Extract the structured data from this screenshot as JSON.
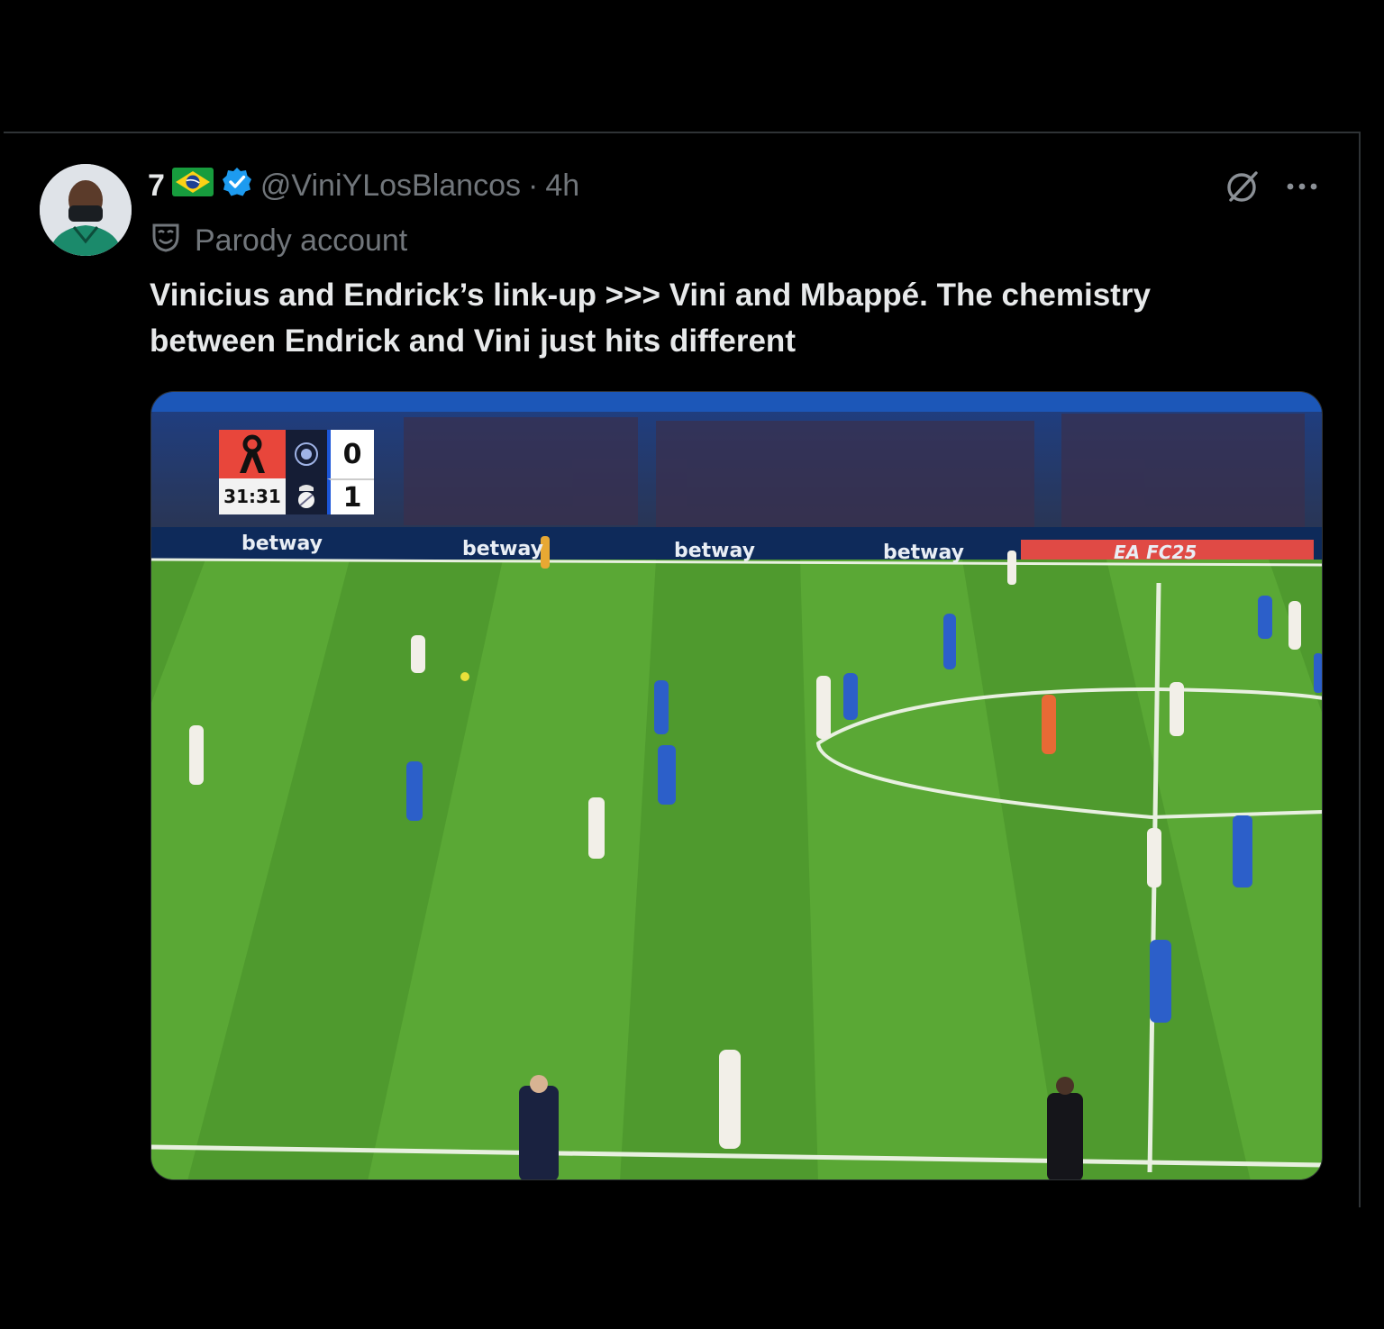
{
  "tweet": {
    "display_name": "7",
    "handle": "@ViniYLosBlancos",
    "separator": "·",
    "time": "4h",
    "parody_label": "Parody account",
    "text": "Vinicius and Endrick’s link-up >>> Vini and Mbappé. The chemistry between Endrick and Vini just hits different",
    "icons": [
      "brazil-flag-icon",
      "verified-badge-icon",
      "parody-mask-icon",
      "grok-icon",
      "more-icon"
    ],
    "colors": {
      "verified": "#1d9bf0",
      "muted": "#71767b",
      "text": "#e7e9ea",
      "background": "#000000"
    }
  },
  "media": {
    "scoreboard": {
      "clock": "31:31",
      "home_score": "0",
      "away_score": "1"
    },
    "ad_boards": [
      "betway",
      "betway",
      "betway",
      "betway",
      "EA FC25"
    ]
  }
}
